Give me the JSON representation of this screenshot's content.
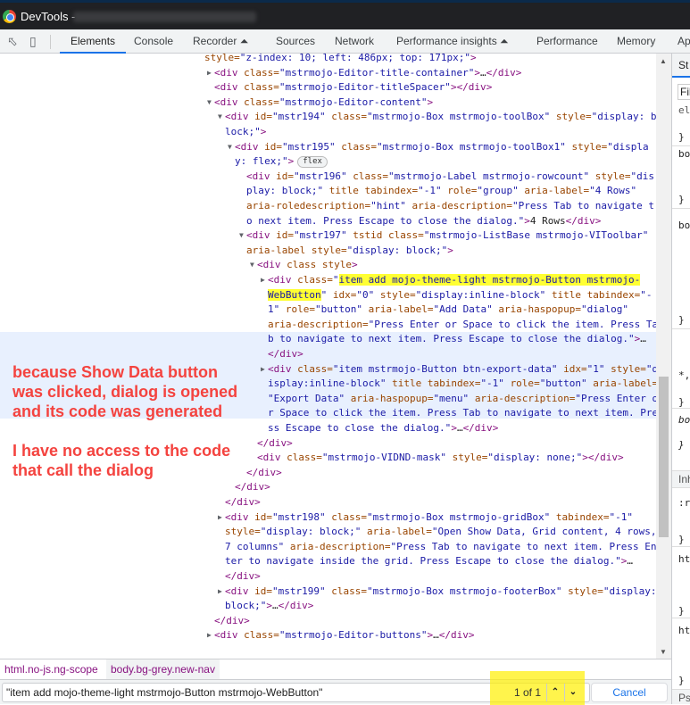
{
  "window": {
    "title": "DevTools -"
  },
  "tabs": [
    {
      "label": "Elements",
      "active": true
    },
    {
      "label": "Console"
    },
    {
      "label": "Recorder ⏶"
    },
    {
      "label": "Sources"
    },
    {
      "label": "Network"
    },
    {
      "label": "Performance insights ⏶"
    },
    {
      "label": "Performance"
    },
    {
      "label": "Memory"
    },
    {
      "label": "Ap"
    }
  ],
  "dom_lines": [
    {
      "text": "style=\"z-index: 10; left: 486px; top: 171px;\">"
    },
    {
      "text": "<div class=\"mstrmojo-Editor-title-container\">…</div>",
      "arrow": "collapsed"
    },
    {
      "text": "<div class=\"mstrmojo-Editor-titleSpacer\"></div>"
    },
    {
      "text": "<div class=\"mstrmojo-Editor-content\">",
      "arrow": "expanded"
    },
    {
      "text": "<div id=\"mstr194\" class=\"mstrmojo-Box mstrmojo-toolBox\" style=\"display: b",
      "arrow": "expanded"
    },
    {
      "text": "lock;\">"
    },
    {
      "text": "<div id=\"mstr195\" class=\"mstrmojo-Box mstrmojo-toolBox1\" style=\"displa",
      "arrow": "expanded"
    },
    {
      "text": "y: flex;\">",
      "badge": "flex"
    },
    {
      "text": "<div id=\"mstr196\" class=\"mstrmojo-Label mstrmojo-rowcount\" style=\"dis"
    },
    {
      "text": "play: block;\" title tabindex=\"-1\" role=\"group\" aria-label=\"4 Rows\""
    },
    {
      "text": "aria-roledescription=\"hint\" aria-description=\"Press Tab to navigate t"
    },
    {
      "text": "o next item. Press Escape to close the dialog.\">4 Rows</div>"
    },
    {
      "text": "<div id=\"mstr197\" tstid class=\"mstrmojo-ListBase mstrmojo-VIToolbar\"",
      "arrow": "expanded"
    },
    {
      "text": "aria-label style=\"display: block;\">"
    },
    {
      "text": "<div class style>",
      "arrow": "expanded"
    },
    {
      "text": "<div class=\"item add mojo-theme-light mstrmojo-Button mstrmojo-",
      "arrow": "collapsed",
      "highlight": "item add mojo-theme-light mstrmojo-Button mstrmojo-"
    },
    {
      "text": "WebButton\" idx=\"0\" style=\"display:inline-block\" title tabindex=\"-",
      "highlight": "WebButton"
    },
    {
      "text": "1\" role=\"button\" aria-label=\"Add Data\" aria-haspopup=\"dialog\""
    },
    {
      "text": "aria-description=\"Press Enter or Space to click the item. Press Ta"
    },
    {
      "text": "b to navigate to next item. Press Escape to close the dialog.\">…"
    },
    {
      "text": "</div>"
    },
    {
      "text": "<div class=\"item mstrmojo-Button btn-export-data\" idx=\"1\" style=\"d",
      "arrow": "collapsed"
    },
    {
      "text": "isplay:inline-block\" title tabindex=\"-1\" role=\"button\" aria-label="
    },
    {
      "text": "\"Export Data\" aria-haspopup=\"menu\" aria-description=\"Press Enter o"
    },
    {
      "text": "r Space to click the item. Press Tab to navigate to next item. Pre"
    },
    {
      "text": "ss Escape to close the dialog.\">…</div>"
    },
    {
      "text": "</div>"
    },
    {
      "text": "<div class=\"mstrmojo-VIDND-mask\" style=\"display: none;\"></div>"
    },
    {
      "text": "</div>"
    },
    {
      "text": "</div>"
    },
    {
      "text": "</div>"
    },
    {
      "text": "<div id=\"mstr198\" class=\"mstrmojo-Box mstrmojo-gridBox\" tabindex=\"-1\"",
      "arrow": "collapsed"
    },
    {
      "text": "style=\"display: block;\" aria-label=\"Open Show Data, Grid content, 4 rows,"
    },
    {
      "text": "7 columns\" aria-description=\"Press Tab to navigate to next item. Press En"
    },
    {
      "text": "ter to navigate inside the grid. Press Escape to close the dialog.\">…"
    },
    {
      "text": "</div>"
    },
    {
      "text": "<div id=\"mstr199\" class=\"mstrmojo-Box mstrmojo-footerBox\" style=\"display:",
      "arrow": "collapsed"
    },
    {
      "text": "block;\">…</div>"
    },
    {
      "text": "</div>"
    },
    {
      "text": "<div class=\"mstrmojo-Editor-buttons\">…</div>",
      "arrow": "collapsed"
    }
  ],
  "annotation": {
    "paragraphs": [
      "because Show Data button was clicked, dialog is opened and its code was generated",
      "I have no access to the code that call the dialog"
    ],
    "color": "#f4433f"
  },
  "styles_panel": {
    "items": [
      "St",
      "Fil",
      "ele",
      "}",
      "bo",
      "}",
      "bo",
      "}",
      "*,",
      "}",
      "bo",
      "}",
      "Inh",
      ":r",
      "}",
      "htr",
      "}",
      "htr",
      "}",
      "Pse",
      "*,",
      "}"
    ]
  },
  "breadcrumbs": [
    "html.no-js.ng-scope",
    "body.bg-grey.new-nav"
  ],
  "search": {
    "query": "\"item add mojo-theme-light mstrmojo-Button mstrmojo-WebButton\"",
    "match_count": "1 of 1",
    "prev_icon": "chevron-up-icon",
    "next_icon": "chevron-down-icon",
    "cancel_label": "Cancel"
  },
  "colors": {
    "accent": "#1a73e8",
    "tag": "#881280",
    "attr": "#994500",
    "value": "#1a1aa6",
    "search_highlight": "#ffff33",
    "selected_row": "#e8f0fe"
  }
}
